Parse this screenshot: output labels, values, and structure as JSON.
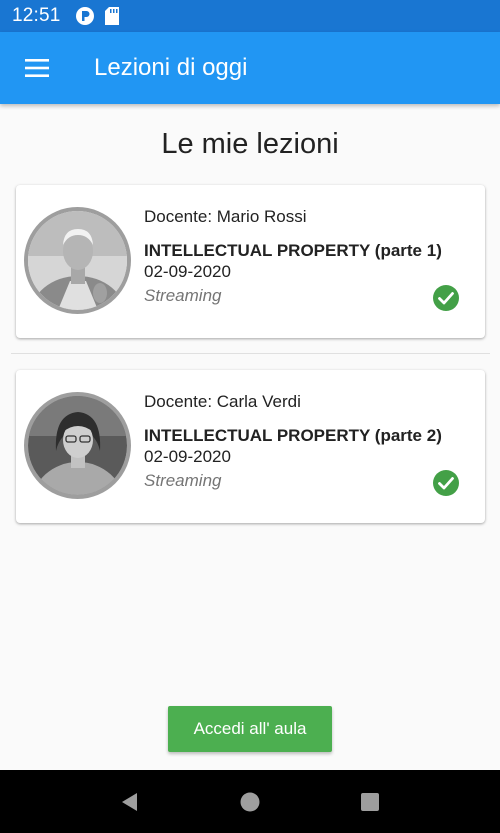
{
  "status_bar": {
    "time": "12:51"
  },
  "app_bar": {
    "title": "Lezioni di oggi",
    "menu_icon": "menu-icon"
  },
  "main": {
    "heading": "Le mie lezioni",
    "lessons": [
      {
        "teacher_label": "Docente: Mario Rossi",
        "course": "INTELLECTUAL PROPERTY (parte 1)",
        "date": "02-09-2020",
        "mode": "Streaming",
        "status_icon": "check-circle-icon"
      },
      {
        "teacher_label": "Docente: Carla Verdi",
        "course": "INTELLECTUAL PROPERTY (parte 2)",
        "date": "02-09-2020",
        "mode": "Streaming",
        "status_icon": "check-circle-icon"
      }
    ],
    "enter_button_label": "Accedi all' aula"
  },
  "colors": {
    "status_bar": "#1976d2",
    "app_bar": "#2196f3",
    "check": "#43a047",
    "button": "#4caf50"
  }
}
